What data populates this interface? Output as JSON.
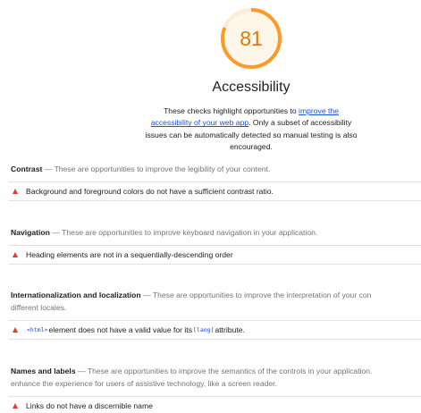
{
  "category": {
    "score": "81",
    "score_value": 81,
    "title": "Accessibility",
    "description_before": "These checks highlight opportunities to ",
    "description_link": "improve the accessibility of your web app",
    "description_after": ". Only a subset of accessibility issues can be automatically detected so manual testing is also encouraged.",
    "colors": {
      "gauge_average": "#fc9a28",
      "gauge_track": "#fdebd5",
      "score_text": "#e67700",
      "fail_red": "#e8382e",
      "link": "#1a56d6"
    }
  },
  "groups": [
    {
      "name": "Contrast",
      "dash": " — ",
      "description": "These are opportunities to improve the legibility of your content.",
      "audits": [
        {
          "icon": "fail-triangle-icon",
          "text": "Background and foreground colors do not have a sufficient contrast ratio."
        }
      ]
    },
    {
      "name": "Navigation",
      "dash": " — ",
      "description": "These are opportunities to improve keyboard navigation in your application.",
      "audits": [
        {
          "icon": "fail-triangle-icon",
          "text": "Heading elements are not in a sequentially-descending order"
        }
      ]
    },
    {
      "name": "Internationalization and localization",
      "dash": " — ",
      "description": "These are opportunities to improve the interpretation of your con",
      "description_line2": "different locales.",
      "audits": [
        {
          "icon": "fail-triangle-icon",
          "code_html": "<html>",
          "middle": " element does not have a valid value for its ",
          "code_lang": "[lang]",
          "end": " attribute."
        }
      ]
    },
    {
      "name": "Names and labels",
      "dash": " — ",
      "description": "These are opportunities to improve the semantics of the controls in your application.",
      "description_line2": "enhance the experience for users of assistive technology, like a screen reader.",
      "audits": [
        {
          "icon": "fail-triangle-icon",
          "text": "Links do not have a discernible name"
        }
      ]
    }
  ]
}
